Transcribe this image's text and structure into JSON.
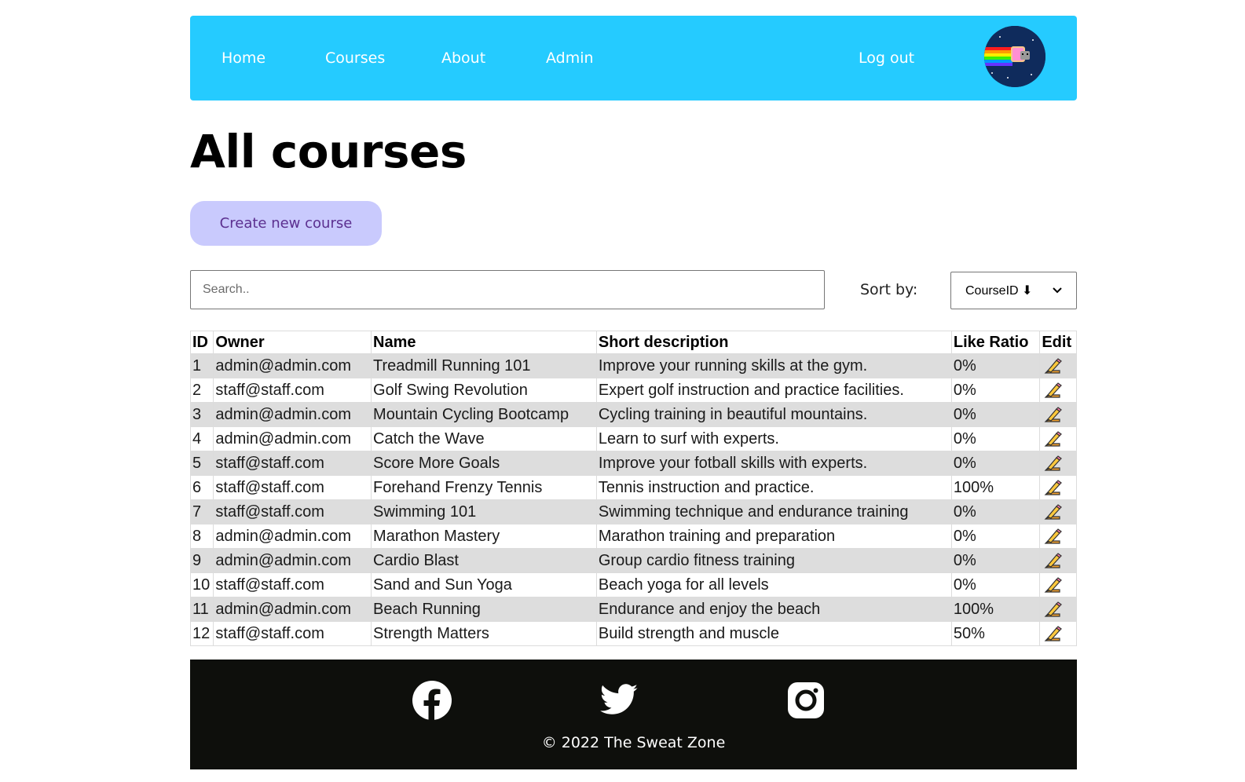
{
  "nav": {
    "items": [
      {
        "label": "Home"
      },
      {
        "label": "Courses"
      },
      {
        "label": "About"
      },
      {
        "label": "Admin"
      }
    ],
    "logout_label": "Log out",
    "avatar_icon": "nyan-cat-avatar-icon"
  },
  "page": {
    "title": "All courses",
    "create_button_label": "Create new course"
  },
  "search": {
    "placeholder": "Search..",
    "value": ""
  },
  "sort": {
    "label": "Sort by:",
    "selected": "CourseID ⬇"
  },
  "table": {
    "headers": [
      "ID",
      "Owner",
      "Name",
      "Short description",
      "Like Ratio",
      "Edit"
    ],
    "rows": [
      {
        "id": "1",
        "owner": "admin@admin.com",
        "name": "Treadmill Running 101",
        "description": "Improve your running skills at the gym.",
        "like_ratio": "0%"
      },
      {
        "id": "2",
        "owner": "staff@staff.com",
        "name": "Golf Swing Revolution",
        "description": "Expert golf instruction and practice facilities.",
        "like_ratio": "0%"
      },
      {
        "id": "3",
        "owner": "admin@admin.com",
        "name": "Mountain Cycling Bootcamp",
        "description": "Cycling training in beautiful mountains.",
        "like_ratio": "0%"
      },
      {
        "id": "4",
        "owner": "admin@admin.com",
        "name": "Catch the Wave",
        "description": "Learn to surf with experts.",
        "like_ratio": "0%"
      },
      {
        "id": "5",
        "owner": "staff@staff.com",
        "name": "Score More Goals",
        "description": "Improve your fotball skills with experts.",
        "like_ratio": "0%"
      },
      {
        "id": "6",
        "owner": "staff@staff.com",
        "name": "Forehand Frenzy Tennis",
        "description": "Tennis instruction and practice.",
        "like_ratio": "100%"
      },
      {
        "id": "7",
        "owner": "staff@staff.com",
        "name": "Swimming 101",
        "description": "Swimming technique and endurance training",
        "like_ratio": "0%"
      },
      {
        "id": "8",
        "owner": "admin@admin.com",
        "name": "Marathon Mastery",
        "description": "Marathon training and preparation",
        "like_ratio": "0%"
      },
      {
        "id": "9",
        "owner": "admin@admin.com",
        "name": "Cardio Blast",
        "description": "Group cardio fitness training",
        "like_ratio": "0%"
      },
      {
        "id": "10",
        "owner": "staff@staff.com",
        "name": "Sand and Sun Yoga",
        "description": "Beach yoga for all levels",
        "like_ratio": "0%"
      },
      {
        "id": "11",
        "owner": "admin@admin.com",
        "name": "Beach Running",
        "description": "Endurance and enjoy the beach",
        "like_ratio": "100%"
      },
      {
        "id": "12",
        "owner": "staff@staff.com",
        "name": "Strength Matters",
        "description": "Build strength and muscle",
        "like_ratio": "50%"
      }
    ],
    "edit_icon": "pencil-edit-icon"
  },
  "footer": {
    "social": [
      "facebook-icon",
      "twitter-icon",
      "instagram-icon"
    ],
    "copyright": "© 2022 The Sweat Zone"
  },
  "colors": {
    "nav_bg": "#25cbff",
    "create_button_bg": "#c9cafd",
    "create_button_text": "#5b2f8f",
    "footer_bg": "#0e0f0c",
    "row_stripe": "#dddddd"
  }
}
